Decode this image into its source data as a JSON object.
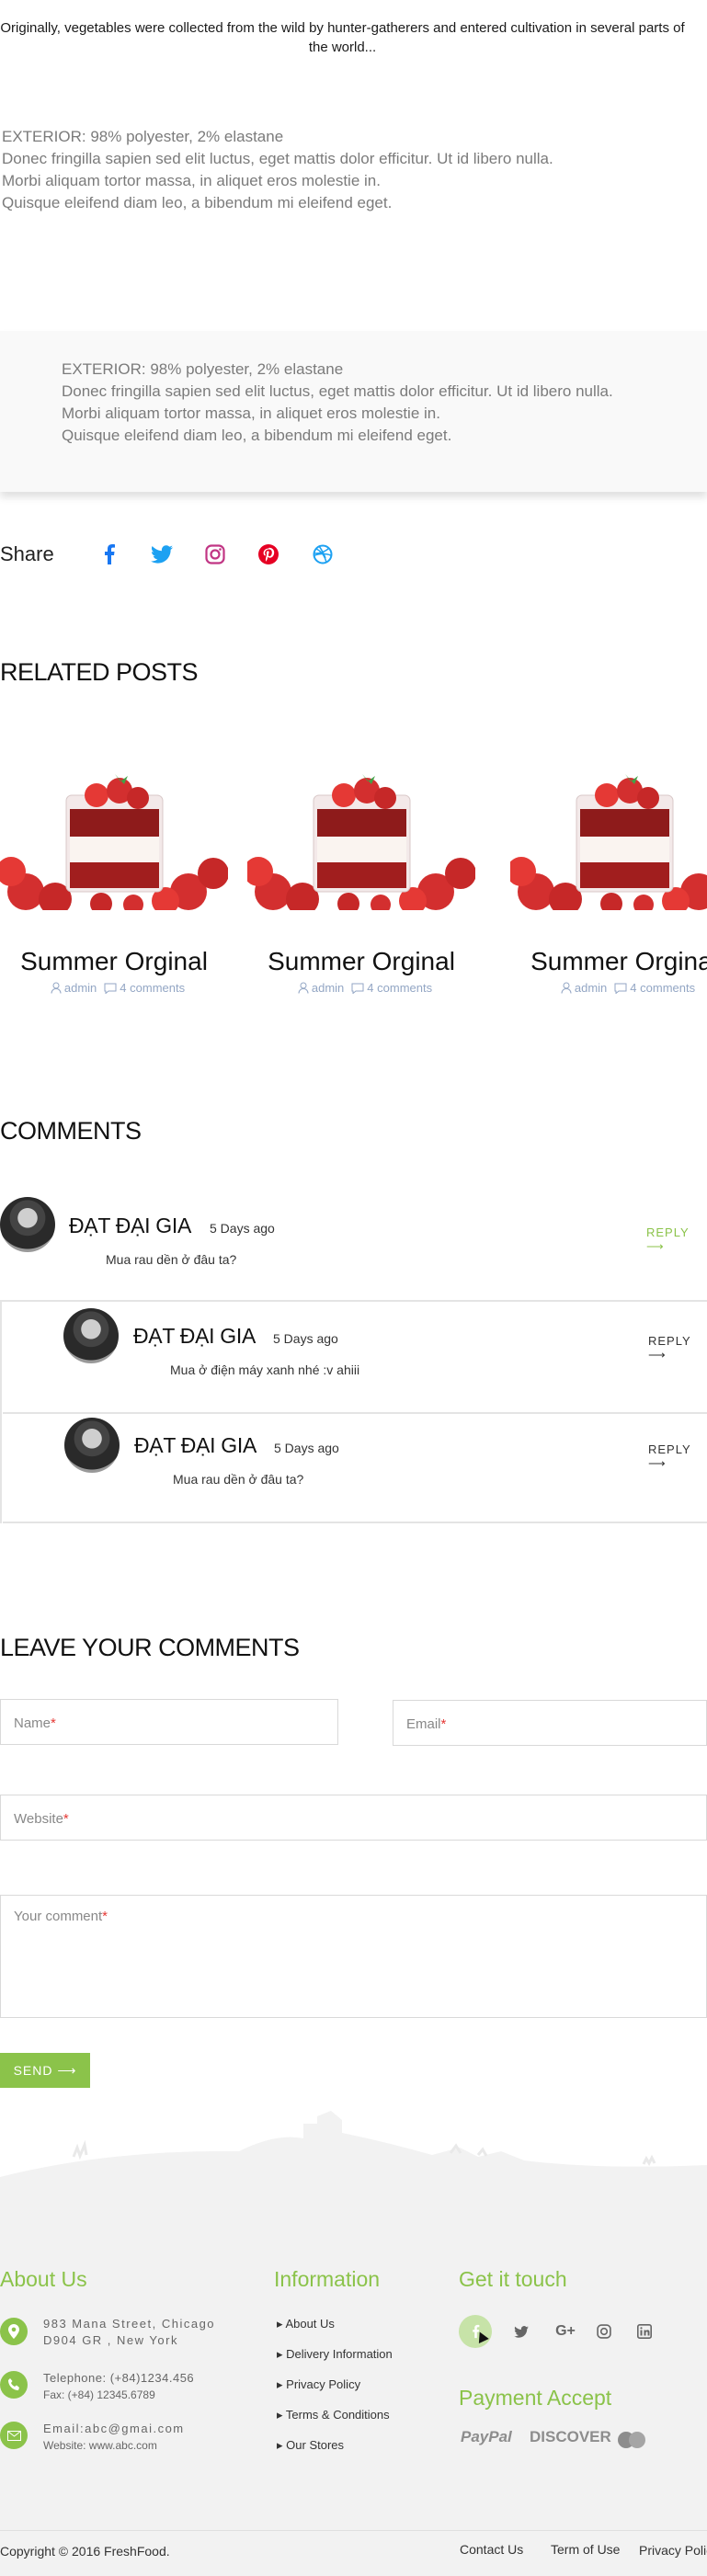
{
  "intro": "Originally, vegetables were collected from the wild by hunter-gatherers and entered cultivation in several parts of the world...",
  "spec_lines": [
    "EXTERIOR: 98% polyester, 2% elastane",
    "Donec fringilla sapien sed elit luctus, eget mattis dolor efficitur. Ut id libero nulla.",
    "Morbi aliquam tortor massa, in aliquet eros molestie in.",
    "Quisque eleifend diam leo, a bibendum mi eleifend eget."
  ],
  "share": {
    "label": "Share",
    "icons": [
      "facebook-icon",
      "twitter-icon",
      "instagram-icon",
      "pinterest-icon",
      "dribbble-icon"
    ],
    "colors": {
      "facebook": "#1877f2",
      "twitter": "#1da1f2",
      "instagram": "#c13584",
      "pinterest": "#e60023",
      "dribbble": "#1da1f2"
    }
  },
  "related": {
    "title": "RELATED POSTS",
    "posts": [
      {
        "title": "Summer Orginal",
        "author": "admin",
        "comments": "4 comments"
      },
      {
        "title": "Summer Orginal",
        "author": "admin",
        "comments": "4 comments"
      },
      {
        "title": "Summer Orginal",
        "author": "admin",
        "comments": "4 comments"
      }
    ]
  },
  "comments": {
    "title": "COMMENTS",
    "items": [
      {
        "name": "ĐẠT ĐẠI GIA",
        "date": "5 Days ago",
        "text": "Mua rau dền ở đâu ta?",
        "reply": "REPLY"
      },
      {
        "name": "ĐẠT ĐẠI GIA",
        "date": "5 Days ago",
        "text": "Mua ở điện máy xanh nhé :v ahiii",
        "reply": "REPLY"
      },
      {
        "name": "ĐẠT ĐẠI GIA",
        "date": "5 Days ago",
        "text": "Mua rau dền ở đâu ta?",
        "reply": "REPLY"
      }
    ]
  },
  "leave": {
    "title": "LEAVE YOUR COMMENTS",
    "name_label": "Name",
    "email_label": "Email",
    "website_label": "Website",
    "comment_label": "Your comment",
    "required_mark": "*",
    "send": "SEND"
  },
  "footer": {
    "about": {
      "title": "About Us",
      "address": [
        "983 Mana Street, Chicago",
        "D904 GR , New York"
      ],
      "phone": "Telephone: (+84)1234.456",
      "fax": "Fax: (+84) 12345.6789",
      "email": "Email:abc@gmai.com",
      "website": "Website: www.abc.com"
    },
    "information": {
      "title": "Information",
      "links": [
        "About Us",
        "Delivery Information",
        "Privacy Policy",
        "Terms & Conditions",
        "Our Stores"
      ]
    },
    "touch": {
      "title": "Get it touch",
      "icons": [
        "facebook-icon",
        "twitter-icon",
        "google-plus-icon",
        "instagram-icon",
        "linkedin-icon"
      ]
    },
    "payment": {
      "title": "Payment Accept",
      "methods": [
        "PayPal",
        "DISCOVER"
      ]
    },
    "copyright": "Copyright ©  2016 FreshFood.",
    "bottom_links": [
      "Contact Us",
      "Term of Use",
      "Privacy Policy"
    ]
  },
  "accent": "#8bc34a"
}
